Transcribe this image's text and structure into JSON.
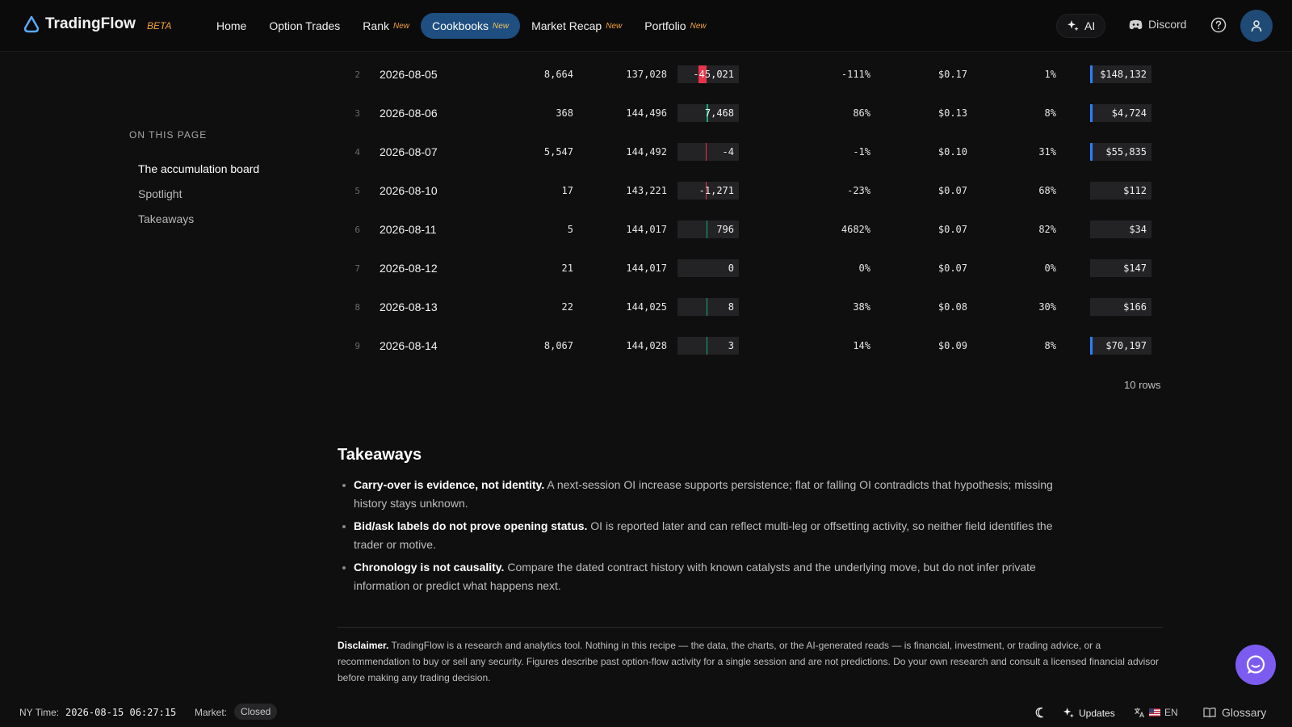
{
  "app": {
    "name": "TradingFlow",
    "badge": "BETA"
  },
  "nav": {
    "items": [
      {
        "label": "Home",
        "new": ""
      },
      {
        "label": "Option Trades",
        "new": ""
      },
      {
        "label": "Rank",
        "new": "New"
      },
      {
        "label": "Cookbooks",
        "new": "New"
      },
      {
        "label": "Market Recap",
        "new": "New"
      },
      {
        "label": "Portfolio",
        "new": "New"
      }
    ],
    "active": "Cookbooks",
    "ai_label": "AI",
    "discord_label": "Discord"
  },
  "toc": {
    "title": "ON THIS PAGE",
    "items": [
      {
        "label": "The accumulation board"
      },
      {
        "label": "Spotlight"
      },
      {
        "label": "Takeaways"
      }
    ]
  },
  "table": {
    "rows": [
      {
        "idx": "2",
        "date": "2026-08-05",
        "vol": "8,664",
        "oi": "137,028",
        "chg": "-45,021",
        "chg_value": -45021,
        "pct": "-111%",
        "prem": "$0.17",
        "pct2": "1%",
        "value": "$148,132",
        "value_accent": true
      },
      {
        "idx": "3",
        "date": "2026-08-06",
        "vol": "368",
        "oi": "144,496",
        "chg": "7,468",
        "chg_value": 7468,
        "pct": "86%",
        "prem": "$0.13",
        "pct2": "8%",
        "value": "$4,724",
        "value_accent": true
      },
      {
        "idx": "4",
        "date": "2026-08-07",
        "vol": "5,547",
        "oi": "144,492",
        "chg": "-4",
        "chg_value": -4,
        "pct": "-1%",
        "prem": "$0.10",
        "pct2": "31%",
        "value": "$55,835",
        "value_accent": true
      },
      {
        "idx": "5",
        "date": "2026-08-10",
        "vol": "17",
        "oi": "143,221",
        "chg": "-1,271",
        "chg_value": -1271,
        "pct": "-23%",
        "prem": "$0.07",
        "pct2": "68%",
        "value": "$112",
        "value_accent": false
      },
      {
        "idx": "6",
        "date": "2026-08-11",
        "vol": "5",
        "oi": "144,017",
        "chg": "796",
        "chg_value": 796,
        "pct": "4682%",
        "prem": "$0.07",
        "pct2": "82%",
        "value": "$34",
        "value_accent": false
      },
      {
        "idx": "7",
        "date": "2026-08-12",
        "vol": "21",
        "oi": "144,017",
        "chg": "0",
        "chg_value": 0,
        "pct": "0%",
        "prem": "$0.07",
        "pct2": "0%",
        "value": "$147",
        "value_accent": false
      },
      {
        "idx": "8",
        "date": "2026-08-13",
        "vol": "22",
        "oi": "144,025",
        "chg": "8",
        "chg_value": 8,
        "pct": "38%",
        "prem": "$0.08",
        "pct2": "30%",
        "value": "$166",
        "value_accent": false
      },
      {
        "idx": "9",
        "date": "2026-08-14",
        "vol": "8,067",
        "oi": "144,028",
        "chg": "3",
        "chg_value": 3,
        "pct": "14%",
        "prem": "$0.09",
        "pct2": "8%",
        "value": "$70,197",
        "value_accent": true
      }
    ],
    "rows_count": "10 rows",
    "colors": {
      "negative": "#e8334a",
      "positive": "#19a974",
      "accent": "#2d7ff9"
    }
  },
  "takeaways": {
    "title": "Takeaways",
    "items": [
      {
        "bold": "Carry-over is evidence, not identity.",
        "text": "A next-session OI increase supports persistence; flat or falling OI contradicts that hypothesis; missing history stays unknown."
      },
      {
        "bold": "Bid/ask labels do not prove opening status.",
        "text": "OI is reported later and can reflect multi-leg or offsetting activity, so neither field identifies the trader or motive."
      },
      {
        "bold": "Chronology is not causality.",
        "text": "Compare the dated contract history with known catalysts and the underlying move, but do not infer private information or predict what happens next."
      }
    ]
  },
  "disclaimer": {
    "label": "Disclaimer.",
    "text": "TradingFlow is a research and analytics tool. Nothing in this recipe — the data, the charts, or the AI-generated reads — is financial, investment, or trading advice, or a recommendation to buy or sell any security. Figures describe past option-flow activity for a single session and are not predictions. Do your own research and consult a licensed financial advisor before making any trading decision."
  },
  "footer": {
    "ny_label": "NY Time:",
    "ny_time": "2026-08-15 06:27:15",
    "market_label": "Market:",
    "market_status": "Closed",
    "updates_label": "Updates",
    "lang_label": "EN",
    "glossary_label": "Glossary"
  },
  "icons": {
    "logo": "drop-logo-icon",
    "ai": "sparkle-icon",
    "discord": "discord-icon",
    "help": "help-circle-icon",
    "user": "user-icon",
    "chat": "chat-bubble-icon",
    "theme": "moon-icon",
    "updates": "sparkle-icon",
    "language": "translate-icon",
    "glossary": "book-icon"
  }
}
